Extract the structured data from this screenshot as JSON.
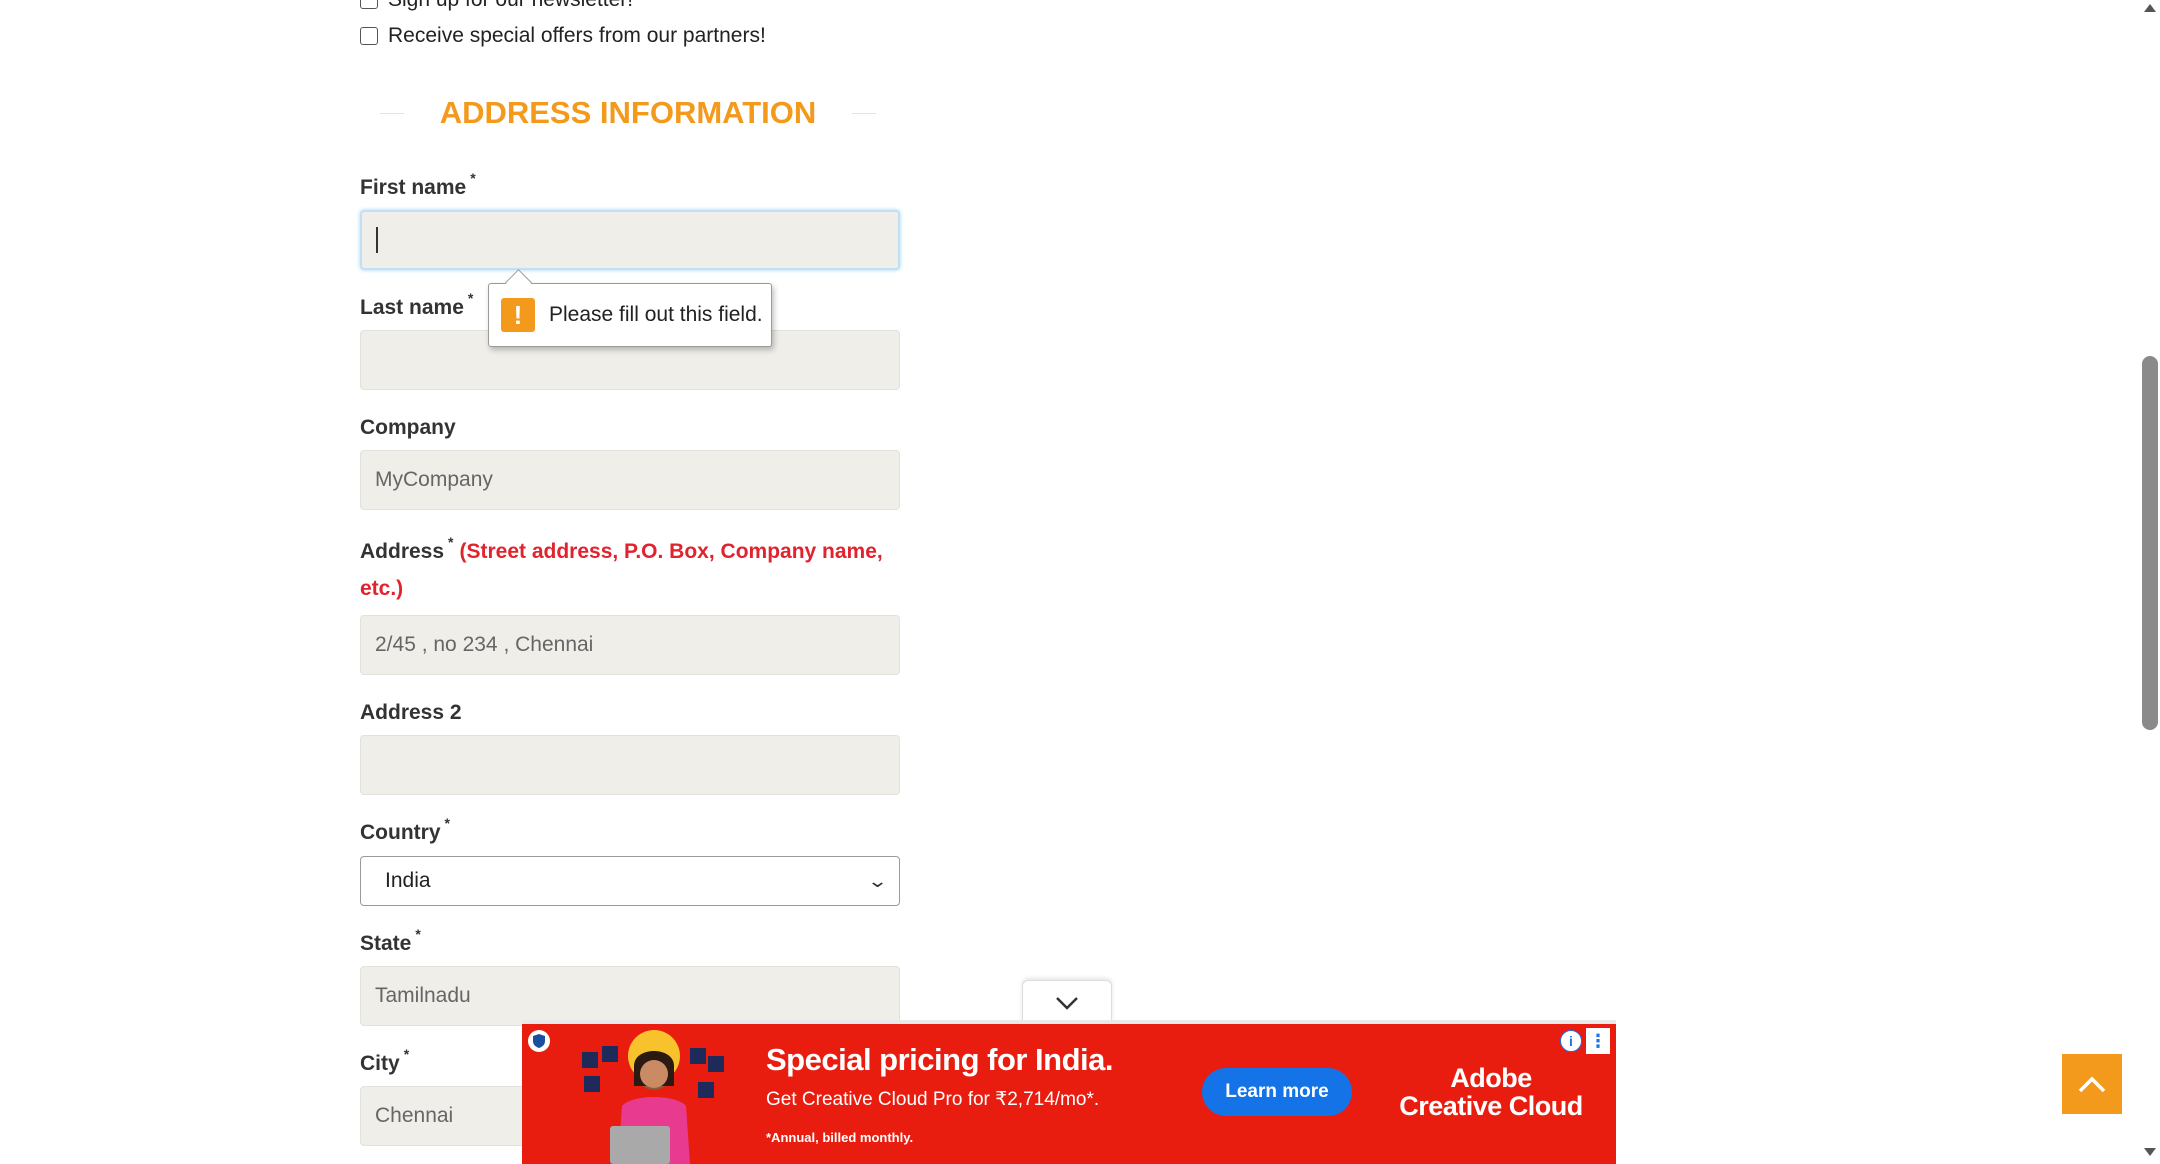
{
  "checkboxes": [
    {
      "label": "Sign up for our newsletter!",
      "checked": false
    },
    {
      "label": "Receive special offers from our partners!",
      "checked": false
    }
  ],
  "section_title": "ADDRESS INFORMATION",
  "form": {
    "first_name": {
      "label": "First name",
      "required": "*",
      "value": ""
    },
    "last_name": {
      "label": "Last name",
      "required": "*",
      "value": ""
    },
    "company": {
      "label": "Company",
      "placeholder": "MyCompany"
    },
    "address": {
      "label": "Address",
      "required": "*",
      "hint": "(Street address, P.O. Box, Company name,",
      "hint2": "etc.)",
      "placeholder": "2/45 , no 234 , Chennai"
    },
    "address2": {
      "label": "Address 2",
      "value": ""
    },
    "country": {
      "label": "Country",
      "required": "*",
      "selected": "India"
    },
    "state": {
      "label": "State",
      "required": "*",
      "placeholder": "Tamilnadu"
    },
    "city": {
      "label": "City",
      "required": "*",
      "placeholder": "Chennai"
    }
  },
  "validation_tooltip": {
    "message": "Please fill out this field.",
    "icon": "warning-icon"
  },
  "ad": {
    "headline": "Special pricing for India.",
    "subtext": "Get Creative Cloud Pro for ₹2,714/mo*.",
    "fineprint": "*Annual, billed monthly.",
    "cta": "Learn more",
    "brand_line1": "Adobe",
    "brand_line2": "Creative Cloud",
    "background_color": "#e81d0f"
  },
  "colors": {
    "accent": "#f39a1d",
    "error": "#e0232e",
    "field_bg": "#efeee9"
  }
}
